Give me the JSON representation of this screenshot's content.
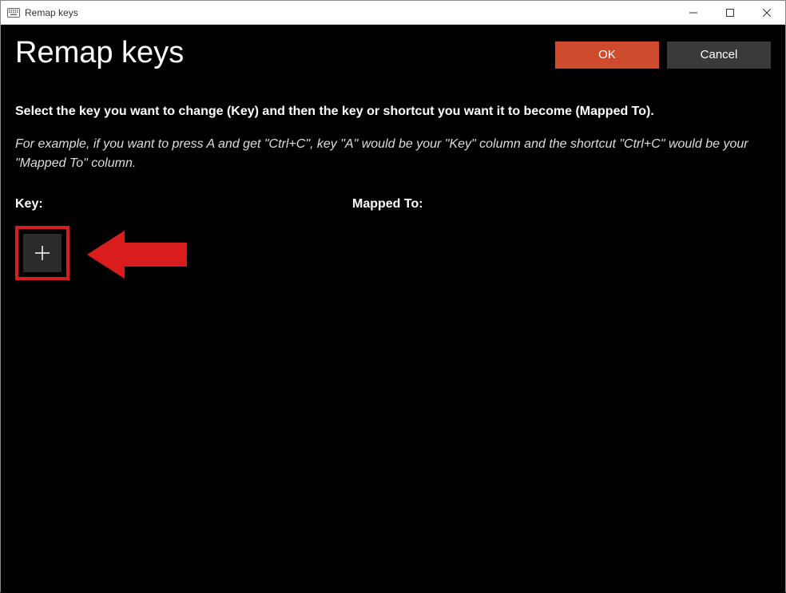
{
  "window": {
    "title": "Remap keys"
  },
  "header": {
    "page_title": "Remap keys",
    "ok_label": "OK",
    "cancel_label": "Cancel"
  },
  "instructions": {
    "main": "Select the key you want to change (Key) and then the key or shortcut you want it to become (Mapped To).",
    "example": "For example, if you want to press A and get \"Ctrl+C\", key \"A\" would be your \"Key\" column and the shortcut \"Ctrl+C\" would be your \"Mapped To\" column."
  },
  "columns": {
    "key_label": "Key:",
    "mapped_label": "Mapped To:"
  },
  "colors": {
    "accent": "#ce4b2d",
    "highlight": "#d91c1c",
    "button_dark": "#3a3a3a"
  }
}
